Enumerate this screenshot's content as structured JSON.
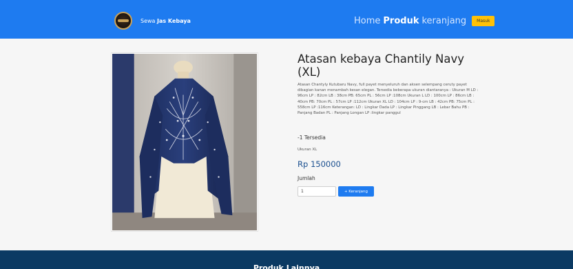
{
  "navbar": {
    "brand_prefix": "Sewa ",
    "brand_bold": "Jas Kebaya",
    "links": [
      "Home",
      "Produk",
      "keranjang"
    ],
    "active_link": "Produk",
    "login_label": "Masuk",
    "accent_color": "#1e7bf0",
    "login_color": "#ffc107"
  },
  "product": {
    "image_alt": "Atasan kebaya Chantily Navy on mannequin",
    "title": "Atasan kebaya Chantily Navy (XL)",
    "description": "Atasan Chantyly Kutubaru Navy, full payet menyeluruh dan aksen selempang ceruty payet dibagian kanan menambah kesan elegan. Tersedia beberapa ukuran diantaranya : Ukuran M LD : 96cm LP : 82cm LB : 38cm PB: 65cm PL : 56cm LP :108cm Ukuran L LD : 100cm LP : 86cm LB : 40cm PB: 70cm PL : 57cm LP :112cm Ukuran XL LD : 104cm LP : 9-cm LB : 42cm PB: 75cm PL : 558cm LP :116cm Keterangan: LD : Lingkar Dada LP : Lingkar Pinggang LB : Lebar Bahu PB : Panjang Badan PL : Panjang Longan LP :lingkar panggul",
    "stock": "-1 Tersedia",
    "size": "Ukuran XL",
    "price": "Rp 150000",
    "quantity_label": "Jumlah",
    "quantity_value": "1",
    "add_to_cart_label": "+ Keranjang",
    "price_color": "#1a4f8f"
  },
  "footer": {
    "title": "Produk Lainnya",
    "background_color": "#0b3a63"
  }
}
